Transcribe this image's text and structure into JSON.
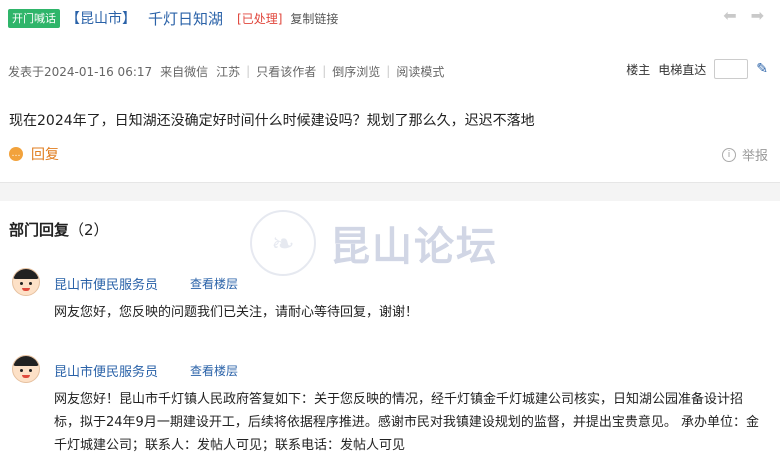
{
  "thread": {
    "tag": "开门喊话",
    "region": "【昆山市】",
    "topic": "千灯日知湖",
    "status": "[已处理]",
    "copy_link": "复制链接",
    "prev_icon": "arrow-left-icon",
    "next_icon": "arrow-right-icon"
  },
  "meta": {
    "posted": "发表于2024-01-16 06:17",
    "source": "来自微信",
    "location": "江苏",
    "only_author": "只看该作者",
    "reverse": "倒序浏览",
    "read_mode": "阅读模式",
    "floor_owner": "楼主",
    "jump_label": "电梯直达",
    "jump_value": ""
  },
  "post": {
    "content": "现在2024年了，日知湖还没确定好时间什么时候建设吗？规划了那么久，迟迟不落地",
    "reply_label": "回复",
    "report_label": "举报"
  },
  "dept": {
    "title": "部门回复",
    "count": "（2）"
  },
  "watermark": {
    "text": "昆山论坛"
  },
  "replies": [
    {
      "name": "昆山市便民服务员",
      "view_floor": "查看楼层",
      "text": "网友您好，您反映的问题我们已关注，请耐心等待回复，谢谢！"
    },
    {
      "name": "昆山市便民服务员",
      "view_floor": "查看楼层",
      "text": "网友您好！昆山市千灯镇人民政府答复如下：关于您反映的情况，经千灯镇金千灯城建公司核实，日知湖公园准备设计招标，拟于24年9月一期建设开工，后续将依据程序推进。感谢市民对我镇建设规划的监督，并提出宝贵意见。 承办单位：金千灯城建公司；联系人：发帖人可见；联系电话：发帖人可见"
    }
  ],
  "colors": {
    "link_blue": "#2a62a8",
    "tag_green": "#2fb56a",
    "status_red": "#e0463c",
    "reply_orange": "#e07d1f"
  }
}
